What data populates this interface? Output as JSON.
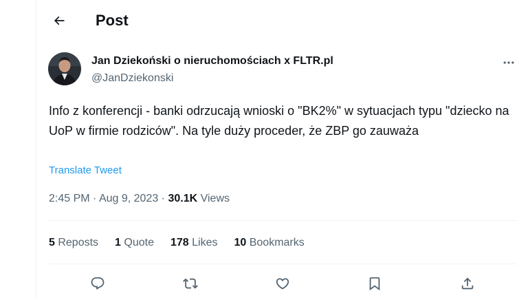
{
  "header": {
    "title": "Post",
    "back_icon": "arrow-left-icon"
  },
  "author": {
    "name": "Jan Dziekoński o nieruchomościach x FLTR.pl",
    "handle": "@JanDziekonski",
    "more_icon": "more-horizontal-icon"
  },
  "tweet": {
    "text": "Info z konferencji - banki odrzucają wnioski o \"BK2%\" w sytuacjach typu \"dziecko na UoP w firmie rodziców\". Na tyle duży proceder, że ZBP go zauważa",
    "translate_label": "Translate Tweet"
  },
  "meta": {
    "time": "2:45 PM",
    "separator": " · ",
    "date": "Aug 9, 2023",
    "separator2": " · ",
    "views_count": "30.1K",
    "views_label": " Views"
  },
  "stats": {
    "reposts_count": "5",
    "reposts_label": " Reposts",
    "quotes_count": "1",
    "quotes_label": " Quote",
    "likes_count": "178",
    "likes_label": " Likes",
    "bookmarks_count": "10",
    "bookmarks_label": " Bookmarks"
  },
  "actions": {
    "reply_icon": "reply-icon",
    "repost_icon": "repost-icon",
    "like_icon": "heart-icon",
    "bookmark_icon": "bookmark-icon",
    "share_icon": "share-icon"
  },
  "colors": {
    "text_primary": "#0f1419",
    "text_secondary": "#536471",
    "link": "#1d9bf0",
    "divider": "#eff3f4"
  }
}
